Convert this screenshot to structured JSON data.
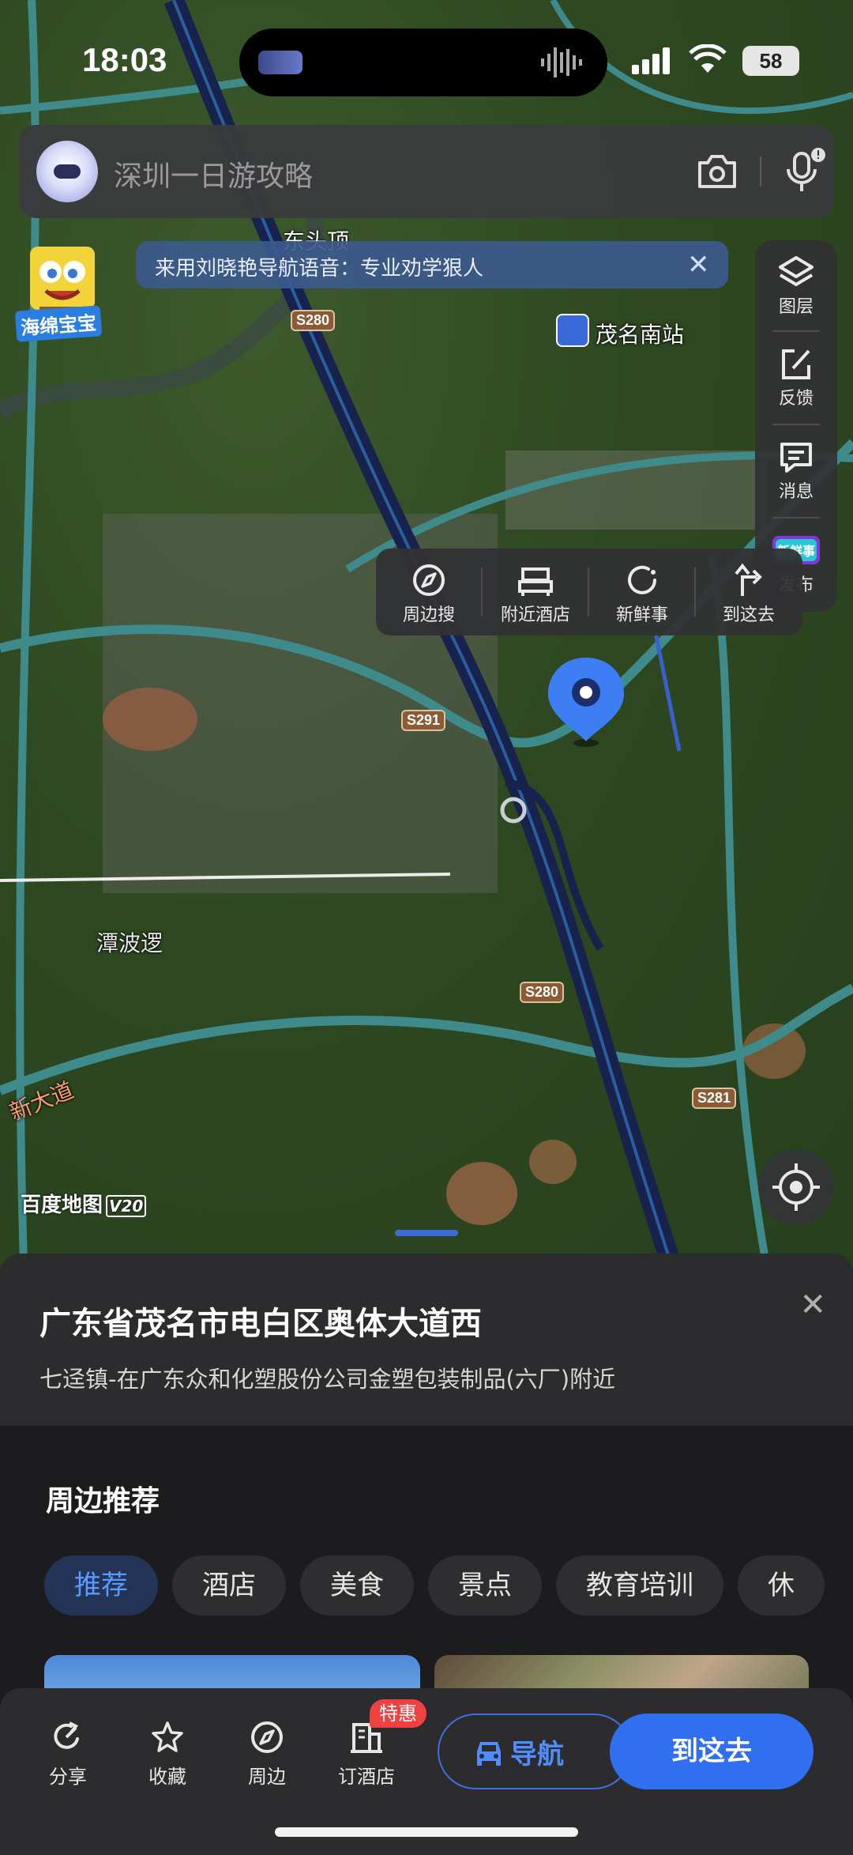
{
  "status": {
    "time": "18:03",
    "battery": "58"
  },
  "search": {
    "placeholder": "深圳一日游攻略"
  },
  "banner": {
    "mascot_label": "海绵宝宝",
    "voice_text": "来用刘晓艳导航语音：专业劝学狠人",
    "close": "✕"
  },
  "tools": [
    {
      "label": "图层",
      "icon": "layers-icon"
    },
    {
      "label": "反馈",
      "icon": "feedback-edit-icon"
    },
    {
      "label": "消息",
      "icon": "message-icon"
    },
    {
      "label": "发布",
      "icon": "xinxianshi-publish-icon",
      "badge": "新鲜事"
    }
  ],
  "popup_actions": [
    {
      "label": "周边搜",
      "icon": "compass-icon"
    },
    {
      "label": "附近酒店",
      "icon": "bed-icon"
    },
    {
      "label": "新鲜事",
      "icon": "refresh-icon"
    },
    {
      "label": "到这去",
      "icon": "turn-arrow-icon"
    }
  ],
  "map": {
    "labels": {
      "station": "茂名南站",
      "north_poi": "东头顶",
      "village": "潭波逻",
      "avenue": "新大道"
    },
    "road_shields": [
      "S280",
      "S291",
      "S280",
      "S281"
    ],
    "logo": "百度地图",
    "logo_version": "V20"
  },
  "place": {
    "title": "广东省茂名市电白区奥体大道西",
    "subtitle": "七迳镇-在广东众和化塑股份公司金塑包装制品(六厂)附近",
    "close": "✕"
  },
  "recommend": {
    "title": "周边推荐",
    "categories": [
      "推荐",
      "酒店",
      "美食",
      "景点",
      "教育培训",
      "休"
    ],
    "active_index": 0
  },
  "actionbar": {
    "items": [
      {
        "label": "分享",
        "icon": "share-icon"
      },
      {
        "label": "收藏",
        "icon": "star-icon"
      },
      {
        "label": "周边",
        "icon": "compass-icon"
      },
      {
        "label": "订酒店",
        "icon": "hotel-icon"
      }
    ],
    "badge": "特惠",
    "nav_label": "导航",
    "go_label": "到这去"
  },
  "colors": {
    "accent": "#2f6ff0",
    "road": "#1f2f66",
    "sheet": "#1c1c1e"
  }
}
